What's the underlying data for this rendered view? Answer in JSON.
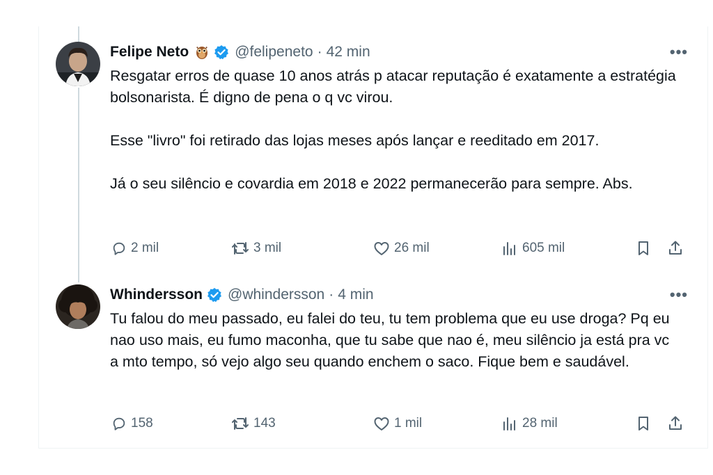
{
  "tweets": [
    {
      "name": "Felipe Neto",
      "handle": "@felipeneto",
      "time": "42 min",
      "paragraphs": [
        "Resgatar erros de quase 10 anos atrás p atacar reputação é exatamente a estratégia bolsonarista. É digno de pena o q vc virou.",
        "Esse \"livro\" foi retirado das lojas meses após lançar e reeditado em 2017.",
        "Já o seu silêncio e covardia em 2018 e 2022 permanecerão para sempre. Abs."
      ],
      "replies": "2 mil",
      "retweets": "3 mil",
      "likes": "26 mil",
      "views": "605 mil"
    },
    {
      "name": "Whindersson",
      "handle": "@whindersson",
      "time": "4 min",
      "paragraphs": [
        "Tu falou do meu passado, eu falei do teu, tu tem problema que eu use droga? Pq eu nao uso mais, eu fumo maconha, que tu sabe que nao é, meu silêncio ja está pra vc a mto tempo, só vejo algo seu quando enchem o saco. Fique bem e saudável."
      ],
      "replies": "158",
      "retweets": "143",
      "likes": "1 mil",
      "views": "28 mil"
    }
  ],
  "separator": "·",
  "more_label": "•••",
  "colors": {
    "verified": "#1d9bf0",
    "muted": "#536471",
    "text": "#0f1419",
    "thread": "#cfd9de"
  }
}
